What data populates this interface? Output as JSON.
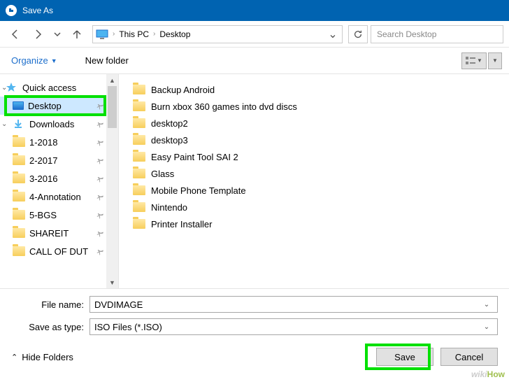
{
  "title": "Save As",
  "breadcrumb": {
    "root": "This PC",
    "folder": "Desktop"
  },
  "search_placeholder": "Search Desktop",
  "toolbar": {
    "organize": "Organize",
    "newfolder": "New folder"
  },
  "sidebar": {
    "quickaccess": "Quick access",
    "items": [
      {
        "label": "Desktop",
        "selected": true,
        "icon": "desktop"
      },
      {
        "label": "Downloads",
        "icon": "dl"
      },
      {
        "label": "1-2018",
        "icon": "folder"
      },
      {
        "label": "2-2017",
        "icon": "folder"
      },
      {
        "label": "3-2016",
        "icon": "folder"
      },
      {
        "label": "4-Annotation",
        "icon": "folder"
      },
      {
        "label": "5-BGS",
        "icon": "folder"
      },
      {
        "label": "SHAREIT",
        "icon": "folder"
      },
      {
        "label": "CALL OF DUT",
        "icon": "folder"
      }
    ]
  },
  "files": [
    "Backup Android",
    "Burn xbox 360 games into dvd discs",
    "desktop2",
    "desktop3",
    "Easy Paint Tool SAI 2",
    "Glass",
    "Mobile Phone Template",
    "Nintendo",
    "Printer Installer"
  ],
  "form": {
    "filename_label": "File name:",
    "filename_value": "DVDIMAGE",
    "type_label": "Save as type:",
    "type_value": "ISO Files (*.ISO)"
  },
  "actions": {
    "hide": "Hide Folders",
    "save": "Save",
    "cancel": "Cancel"
  },
  "watermark": {
    "a": "wiki",
    "b": "How"
  }
}
